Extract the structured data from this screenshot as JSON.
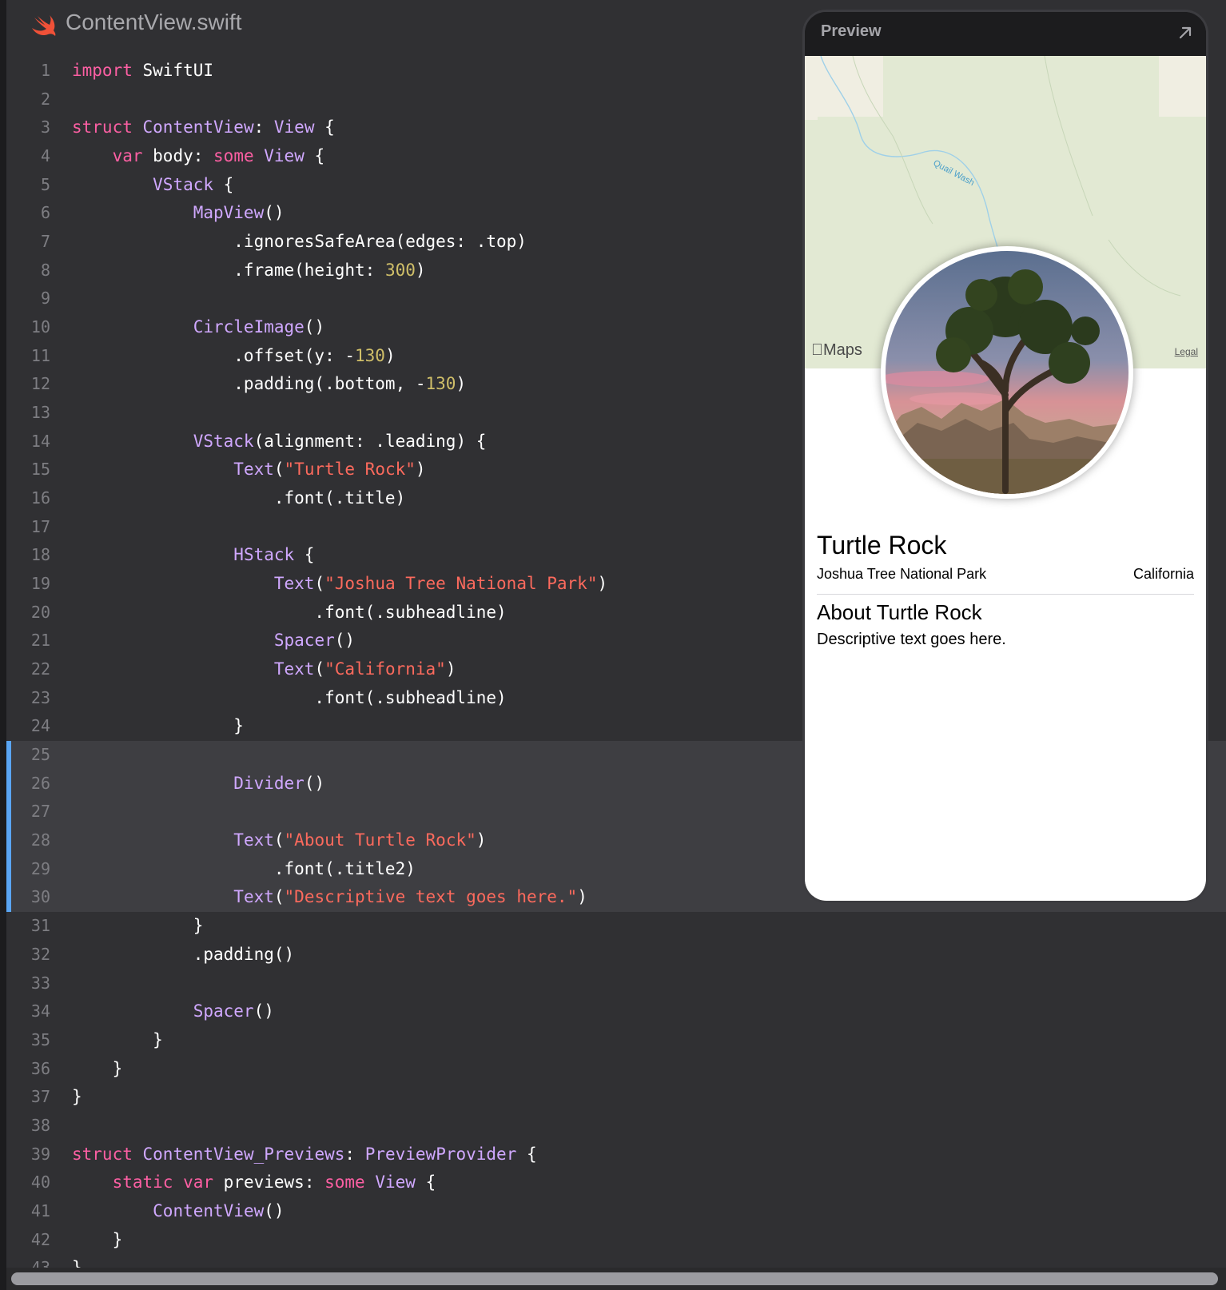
{
  "file": {
    "name": "ContentView.swift",
    "icon": "swift-icon"
  },
  "preview": {
    "title": "Preview",
    "expand_icon": "expand-arrow-icon",
    "map": {
      "brand": "Maps",
      "legal": "Legal",
      "wash_label": "Quail Wash"
    },
    "landmark": {
      "title": "Turtle Rock",
      "park": "Joshua Tree National Park",
      "state": "California",
      "about_title": "About Turtle Rock",
      "description": "Descriptive text goes here."
    }
  },
  "code": {
    "highlighted_lines": [
      25,
      26,
      27,
      28,
      29,
      30
    ],
    "lines": [
      [
        [
          "kw",
          "import"
        ],
        [
          "plain",
          " SwiftUI"
        ]
      ],
      [],
      [
        [
          "kw",
          "struct"
        ],
        [
          "plain",
          " "
        ],
        [
          "ty",
          "ContentView"
        ],
        [
          "plain",
          ": "
        ],
        [
          "ty",
          "View"
        ],
        [
          "plain",
          " {"
        ]
      ],
      [
        [
          "plain",
          "    "
        ],
        [
          "kw",
          "var"
        ],
        [
          "plain",
          " body: "
        ],
        [
          "kw",
          "some"
        ],
        [
          "plain",
          " "
        ],
        [
          "ty",
          "View"
        ],
        [
          "plain",
          " {"
        ]
      ],
      [
        [
          "plain",
          "        "
        ],
        [
          "ty",
          "VStack"
        ],
        [
          "plain",
          " {"
        ]
      ],
      [
        [
          "plain",
          "            "
        ],
        [
          "ty",
          "MapView"
        ],
        [
          "plain",
          "()"
        ]
      ],
      [
        [
          "plain",
          "                .ignoresSafeArea(edges: .top)"
        ]
      ],
      [
        [
          "plain",
          "                .frame(height: "
        ],
        [
          "num",
          "300"
        ],
        [
          "plain",
          ")"
        ]
      ],
      [],
      [
        [
          "plain",
          "            "
        ],
        [
          "ty",
          "CircleImage"
        ],
        [
          "plain",
          "()"
        ]
      ],
      [
        [
          "plain",
          "                .offset(y: -"
        ],
        [
          "num",
          "130"
        ],
        [
          "plain",
          ")"
        ]
      ],
      [
        [
          "plain",
          "                .padding(.bottom, -"
        ],
        [
          "num",
          "130"
        ],
        [
          "plain",
          ")"
        ]
      ],
      [],
      [
        [
          "plain",
          "            "
        ],
        [
          "ty",
          "VStack"
        ],
        [
          "plain",
          "(alignment: .leading) {"
        ]
      ],
      [
        [
          "plain",
          "                "
        ],
        [
          "ty",
          "Text"
        ],
        [
          "plain",
          "("
        ],
        [
          "str",
          "\"Turtle Rock\""
        ],
        [
          "plain",
          ")"
        ]
      ],
      [
        [
          "plain",
          "                    .font(.title)"
        ]
      ],
      [],
      [
        [
          "plain",
          "                "
        ],
        [
          "ty",
          "HStack"
        ],
        [
          "plain",
          " {"
        ]
      ],
      [
        [
          "plain",
          "                    "
        ],
        [
          "ty",
          "Text"
        ],
        [
          "plain",
          "("
        ],
        [
          "str",
          "\"Joshua Tree National Park\""
        ],
        [
          "plain",
          ")"
        ]
      ],
      [
        [
          "plain",
          "                        .font(.subheadline)"
        ]
      ],
      [
        [
          "plain",
          "                    "
        ],
        [
          "ty",
          "Spacer"
        ],
        [
          "plain",
          "()"
        ]
      ],
      [
        [
          "plain",
          "                    "
        ],
        [
          "ty",
          "Text"
        ],
        [
          "plain",
          "("
        ],
        [
          "str",
          "\"California\""
        ],
        [
          "plain",
          ")"
        ]
      ],
      [
        [
          "plain",
          "                        .font(.subheadline)"
        ]
      ],
      [
        [
          "plain",
          "                }"
        ]
      ],
      [],
      [
        [
          "plain",
          "                "
        ],
        [
          "ty",
          "Divider"
        ],
        [
          "plain",
          "()"
        ]
      ],
      [],
      [
        [
          "plain",
          "                "
        ],
        [
          "ty",
          "Text"
        ],
        [
          "plain",
          "("
        ],
        [
          "str",
          "\"About Turtle Rock\""
        ],
        [
          "plain",
          ")"
        ]
      ],
      [
        [
          "plain",
          "                    .font(.title2)"
        ]
      ],
      [
        [
          "plain",
          "                "
        ],
        [
          "ty",
          "Text"
        ],
        [
          "plain",
          "("
        ],
        [
          "str",
          "\"Descriptive text goes here.\""
        ],
        [
          "plain",
          ")"
        ]
      ],
      [
        [
          "plain",
          "            }"
        ]
      ],
      [
        [
          "plain",
          "            .padding()"
        ]
      ],
      [],
      [
        [
          "plain",
          "            "
        ],
        [
          "ty",
          "Spacer"
        ],
        [
          "plain",
          "()"
        ]
      ],
      [
        [
          "plain",
          "        }"
        ]
      ],
      [
        [
          "plain",
          "    }"
        ]
      ],
      [
        [
          "plain",
          "}"
        ]
      ],
      [],
      [
        [
          "kw",
          "struct"
        ],
        [
          "plain",
          " "
        ],
        [
          "ty",
          "ContentView_Previews"
        ],
        [
          "plain",
          ": "
        ],
        [
          "ty",
          "PreviewProvider"
        ],
        [
          "plain",
          " {"
        ]
      ],
      [
        [
          "plain",
          "    "
        ],
        [
          "kw",
          "static"
        ],
        [
          "plain",
          " "
        ],
        [
          "kw",
          "var"
        ],
        [
          "plain",
          " previews: "
        ],
        [
          "kw",
          "some"
        ],
        [
          "plain",
          " "
        ],
        [
          "ty",
          "View"
        ],
        [
          "plain",
          " {"
        ]
      ],
      [
        [
          "plain",
          "        "
        ],
        [
          "ty",
          "ContentView"
        ],
        [
          "plain",
          "()"
        ]
      ],
      [
        [
          "plain",
          "    }"
        ]
      ],
      [
        [
          "plain",
          "}"
        ]
      ]
    ]
  }
}
